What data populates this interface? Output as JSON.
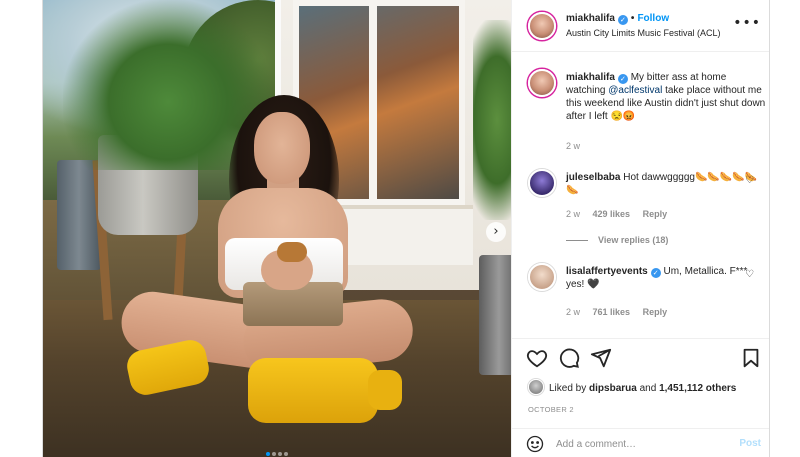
{
  "post": {
    "author": "miakhalifa",
    "follow_label": "Follow",
    "location": "Austin City Limits Music Festival (ACL)",
    "dot": "•",
    "verified_glyph": "✓",
    "more_icon": "more-horizontal-icon",
    "carousel_next": "›",
    "carousel_dots": 4,
    "carousel_active_index": 0
  },
  "caption": {
    "username": "miakhalifa",
    "text_before": "My bitter ass at home watching ",
    "mention": "@aclfestival",
    "text_after": " take place without me this weekend like Austin didn't just shut down after I left 😒😡",
    "time": "2 w"
  },
  "comments": [
    {
      "username": "juleselbaba",
      "verified": false,
      "text": "Hot dawwggggg🌭🌭🌭🌭🌭🌭",
      "time": "2 w",
      "likes": "429 likes",
      "reply": "Reply",
      "view_replies": "View replies (18)"
    },
    {
      "username": "lisalaffertyevents",
      "verified": true,
      "text": "Um, Metallica. F*** yes! 🖤",
      "time": "2 w",
      "likes": "761 likes",
      "reply": "Reply"
    }
  ],
  "actions": {
    "icons": [
      "heart-icon",
      "comment-icon",
      "share-icon",
      "bookmark-icon"
    ],
    "liked_by_prefix": "Liked by ",
    "liked_by_user": "dipsbarua",
    "liked_by_and": " and ",
    "liked_by_count": "1,451,112 others",
    "date": "OCTOBER 2"
  },
  "composer": {
    "placeholder": "Add a comment…",
    "post_label": "Post"
  },
  "colors": {
    "link_blue": "#0095f6",
    "verified_blue": "#3897f0",
    "muted": "#8e8e8e"
  }
}
